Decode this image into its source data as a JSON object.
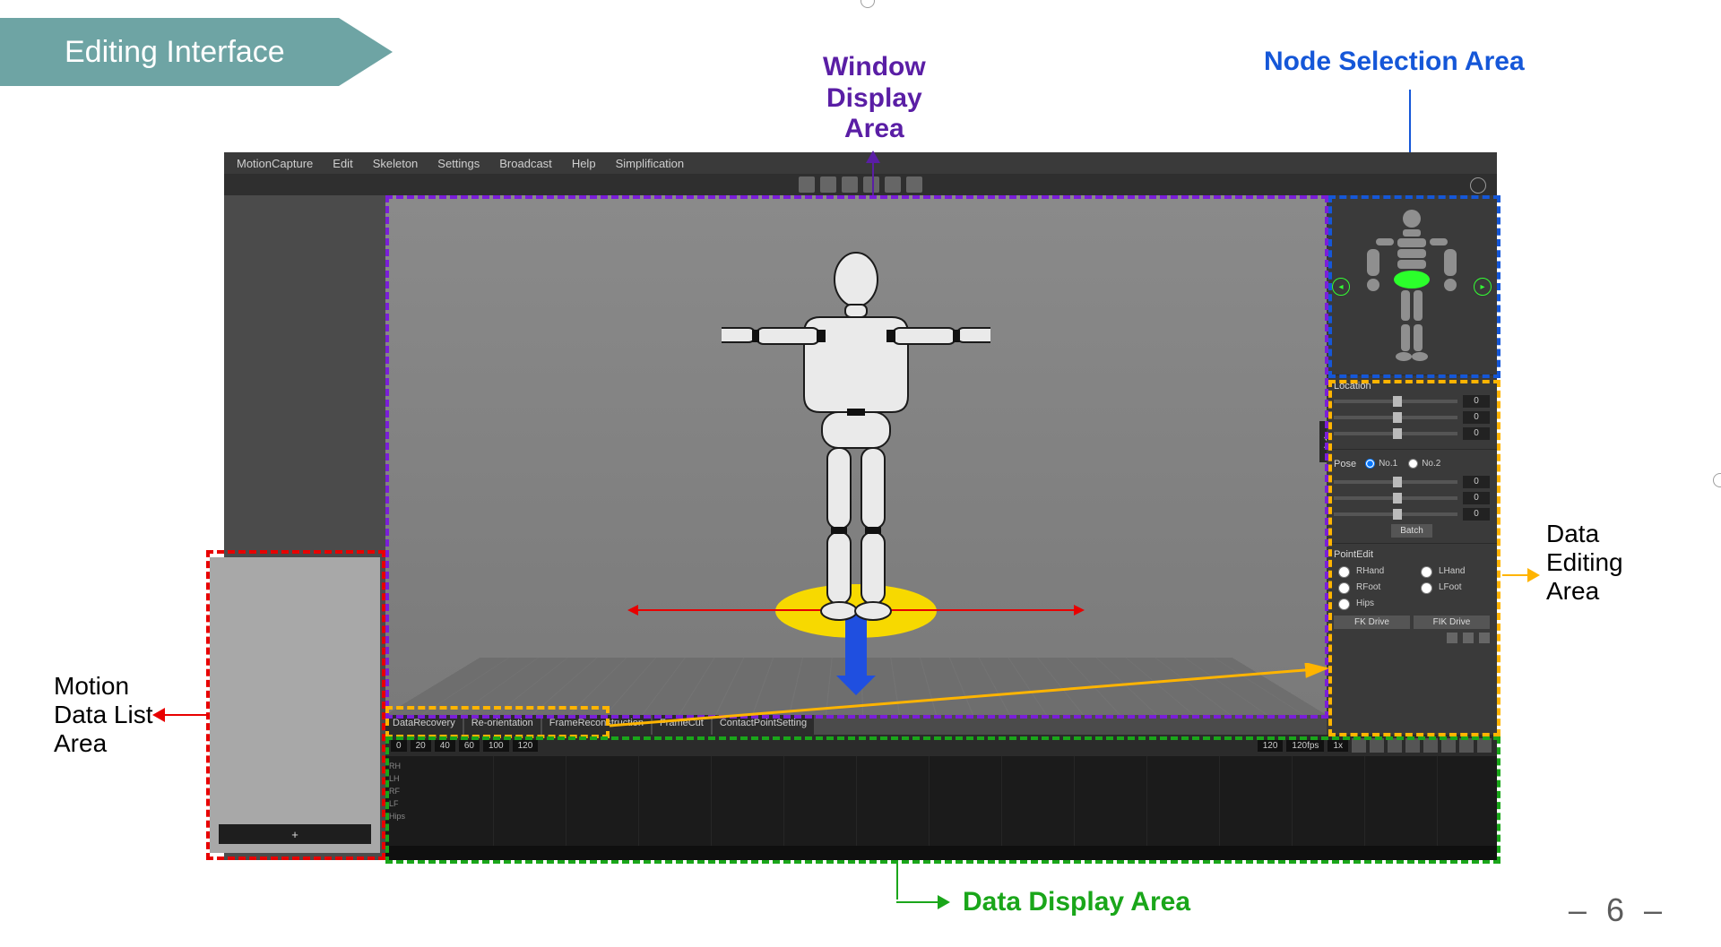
{
  "slide": {
    "title": "Editing Interface",
    "page_number": "– 6 –"
  },
  "callouts": {
    "window_display": "Window\nDisplay\nArea",
    "node_selection": "Node Selection Area",
    "data_editing": "Data\nEditing\nArea",
    "motion_data_list": "Motion\nData List\nArea",
    "data_display": "Data Display Area"
  },
  "app": {
    "menubar": [
      "MotionCapture",
      "Edit",
      "Skeleton",
      "Settings",
      "Broadcast",
      "Help",
      "Simplification"
    ],
    "op_tabs": [
      "DataRecovery",
      "Re-orientation",
      "FrameReconstruction",
      "FrameCut",
      "ContactPointSetting"
    ],
    "motion_list": {
      "add_label": "+"
    },
    "node_nav": {
      "prev": "◂",
      "next": "▸"
    },
    "location": {
      "title": "Location",
      "values": [
        "0",
        "0",
        "0"
      ]
    },
    "pose": {
      "title": "Pose",
      "radios": [
        "No.1",
        "No.2"
      ],
      "values": [
        "0",
        "0",
        "0"
      ],
      "batch_label": "Batch"
    },
    "point_edit": {
      "title": "PointEdit",
      "items": [
        "RHand",
        "LHand",
        "RFoot",
        "LFoot",
        "Hips"
      ]
    },
    "drive": {
      "fk": "FK Drive",
      "fik": "FIK Drive"
    },
    "timeline": {
      "start": "0",
      "ticks": [
        "20",
        "40",
        "60",
        "100",
        "120"
      ],
      "fps": "120fps",
      "speed": "1x",
      "end": "120",
      "tracks": [
        "RH",
        "LH",
        "RF",
        "LF",
        "Hips"
      ]
    },
    "expand_chevron": "❯"
  }
}
